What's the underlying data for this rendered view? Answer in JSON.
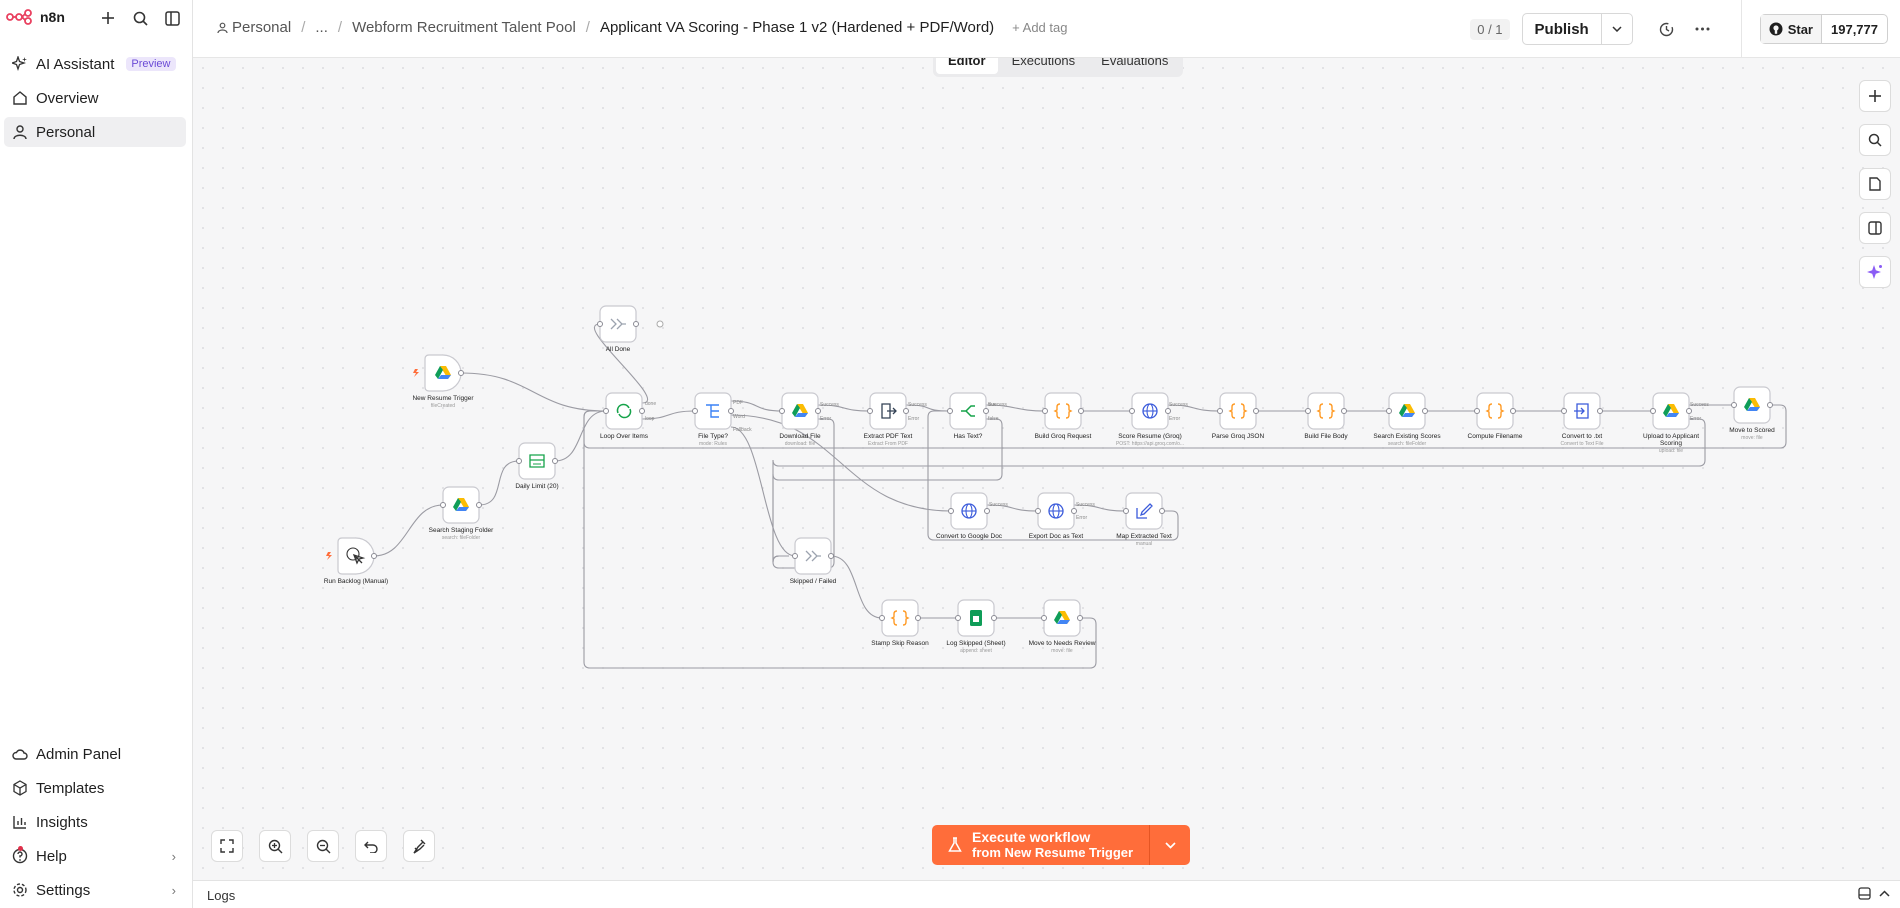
{
  "app": {
    "name": "n8n"
  },
  "sidebar": {
    "top": [
      {
        "label": "AI Assistant",
        "badge": "Preview",
        "icon": "sparkle-icon"
      },
      {
        "label": "Overview",
        "icon": "home-icon"
      },
      {
        "label": "Personal",
        "icon": "user-icon"
      }
    ],
    "bottom": [
      {
        "label": "Admin Panel",
        "icon": "cloud-icon"
      },
      {
        "label": "Templates",
        "icon": "box-icon"
      },
      {
        "label": "Insights",
        "icon": "chart-icon"
      },
      {
        "label": "Help",
        "icon": "help-icon"
      },
      {
        "label": "Settings",
        "icon": "gear-icon"
      }
    ]
  },
  "header": {
    "breadcrumb": [
      "Personal",
      "...",
      "Webform Recruitment Talent Pool"
    ],
    "title": "Applicant VA Scoring - Phase 1 v2 (Hardened + PDF/Word)",
    "add_tag": "+ Add tag",
    "counter": "0 / 1",
    "publish": "Publish",
    "github_star": "Star",
    "github_count": "197,777"
  },
  "tabs": [
    {
      "label": "Editor",
      "active": true
    },
    {
      "label": "Executions",
      "active": false
    },
    {
      "label": "Evaluations",
      "active": false
    }
  ],
  "nodes": [
    {
      "id": "all_done",
      "label": "All Done",
      "sub": "",
      "icon": "noop"
    },
    {
      "id": "trigger",
      "label": "New Resume Trigger",
      "sub": "fileCreated",
      "icon": "gdrive"
    },
    {
      "id": "search_staging",
      "label": "Search Staging Folder",
      "sub": "search: fileFolder",
      "icon": "gdrive"
    },
    {
      "id": "daily_limit",
      "label": "Daily Limit (20)",
      "sub": "",
      "icon": "limit"
    },
    {
      "id": "manual",
      "label": "Run Backlog (Manual)",
      "sub": "",
      "icon": "cursor"
    },
    {
      "id": "loop",
      "label": "Loop Over Items",
      "sub": "",
      "icon": "loop"
    },
    {
      "id": "file_type",
      "label": "File Type?",
      "sub": "mode: Rules",
      "icon": "switch"
    },
    {
      "id": "download",
      "label": "Download File",
      "sub": "download: file",
      "icon": "gdrive"
    },
    {
      "id": "extract_pdf",
      "label": "Extract PDF Text",
      "sub": "Extract From PDF",
      "icon": "extract"
    },
    {
      "id": "has_text",
      "label": "Has Text?",
      "sub": "",
      "icon": "if"
    },
    {
      "id": "build_groq",
      "label": "Build Groq Request",
      "sub": "",
      "icon": "code"
    },
    {
      "id": "score",
      "label": "Score Resume (Groq)",
      "sub": "POST: https://api.groq.com/o...",
      "icon": "http"
    },
    {
      "id": "parse",
      "label": "Parse Groq JSON",
      "sub": "",
      "icon": "code"
    },
    {
      "id": "build_body",
      "label": "Build File Body",
      "sub": "",
      "icon": "code"
    },
    {
      "id": "search_scores",
      "label": "Search Existing Scores",
      "sub": "search: fileFolder",
      "icon": "gdrive"
    },
    {
      "id": "filename",
      "label": "Compute Filename",
      "sub": "",
      "icon": "code"
    },
    {
      "id": "convert_txt",
      "label": "Convert to .txt",
      "sub": "Convert to Text File",
      "icon": "convert"
    },
    {
      "id": "upload",
      "label": "Upload to Applicant",
      "label2": "Scoring",
      "sub": "upload: file",
      "icon": "gdrive"
    },
    {
      "id": "move_scored",
      "label": "Move to Scored",
      "sub": "move: file",
      "icon": "gdrive"
    },
    {
      "id": "convert_gdoc",
      "label": "Convert to Google Doc",
      "sub": "",
      "icon": "http"
    },
    {
      "id": "export_doc",
      "label": "Export Doc as Text",
      "sub": "",
      "icon": "http"
    },
    {
      "id": "map_text",
      "label": "Map Extracted Text",
      "sub": "manual",
      "icon": "edit"
    },
    {
      "id": "skipped",
      "label": "Skipped / Failed",
      "sub": "",
      "icon": "noop"
    },
    {
      "id": "stamp",
      "label": "Stamp Skip Reason",
      "sub": "",
      "icon": "code"
    },
    {
      "id": "log_sheet",
      "label": "Log Skipped (Sheet)",
      "sub": "append: sheet",
      "icon": "sheets"
    },
    {
      "id": "move_review",
      "label": "Move to Needs Review",
      "sub": "move: file",
      "icon": "gdrive"
    }
  ],
  "port_labels": {
    "loop_done": "done",
    "loop_loop": "loop",
    "file_pdf": "PDF",
    "file_word": "Word",
    "file_fallback": "Fallback",
    "success": "Success",
    "error": "Error",
    "true": "true",
    "false": "false"
  },
  "execute": {
    "line1": "Execute workflow",
    "line2": "from New Resume Trigger"
  },
  "logs": {
    "label": "Logs"
  },
  "colors": {
    "accent": "#ff6d3a",
    "edge": "#9b9ba3",
    "node_border": "#c9c9cf"
  }
}
